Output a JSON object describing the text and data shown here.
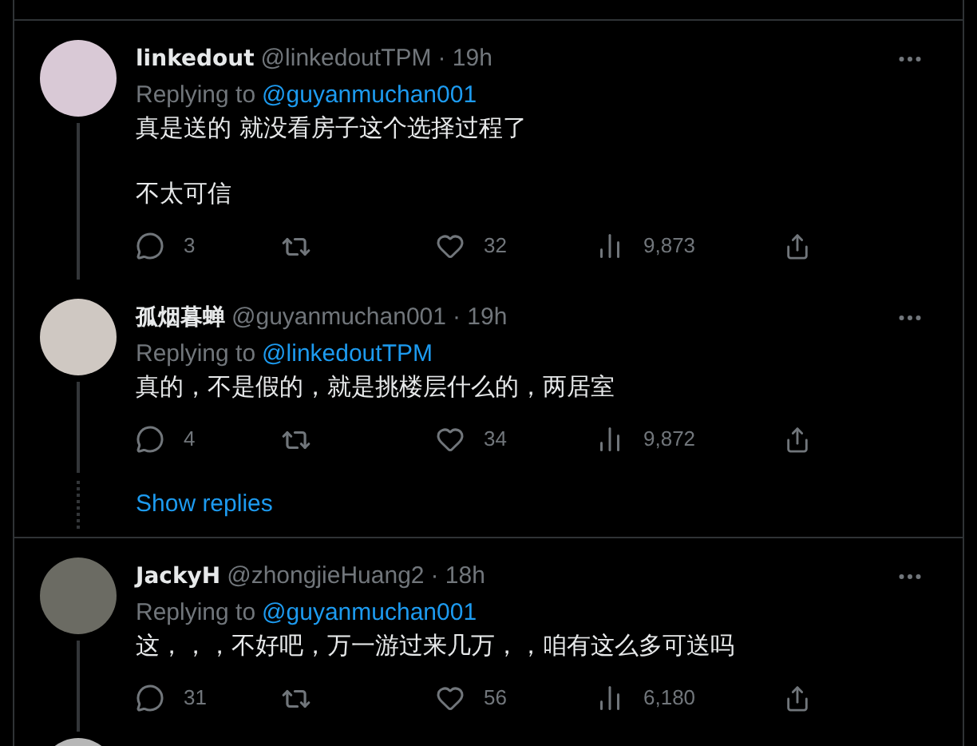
{
  "threads": [
    {
      "tweets": [
        {
          "name": "linkedout",
          "handle": "@linkedoutTPM",
          "time": "· 19h",
          "replying_label": "Replying to",
          "replying_to": "@guyanmuchan001",
          "body": [
            "真是送的 就没看房子这个选择过程了",
            "不太可信"
          ],
          "replies": "3",
          "likes": "32",
          "views": "9,873"
        },
        {
          "name": "孤烟暮蝉",
          "handle": "@guyanmuchan001",
          "time": "· 19h",
          "replying_label": "Replying to",
          "replying_to": "@linkedoutTPM",
          "body": [
            "真的，不是假的，就是挑楼层什么的，两居室"
          ],
          "replies": "4",
          "likes": "34",
          "views": "9,872"
        }
      ],
      "show_replies": "Show replies"
    },
    {
      "tweets": [
        {
          "name": "JackyH",
          "handle": "@zhongjieHuang2",
          "time": "· 18h",
          "replying_label": "Replying to",
          "replying_to": "@guyanmuchan001",
          "body": [
            "这，，，不好吧，万一游过来几万，，咱有这么多可送吗"
          ],
          "replies": "31",
          "likes": "56",
          "views": "6,180"
        }
      ],
      "more_below": true
    }
  ]
}
